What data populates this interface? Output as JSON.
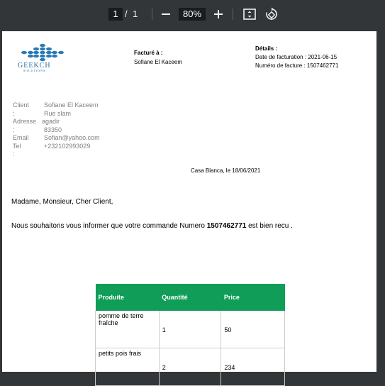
{
  "toolbar": {
    "current_page": "1",
    "separator": "/",
    "total_pages": "1",
    "zoom": "80%",
    "icons": [
      "zoom-out-icon",
      "zoom-in-icon",
      "fit-page-icon",
      "rotate-icon"
    ]
  },
  "invoice": {
    "logo_text": "GEEKCH",
    "logo_sub": "SOLUTIONS",
    "billed_to_label": "Facturé à :",
    "billed_to_name": "Sofiane El Kaceem",
    "details_label": "Détails :",
    "invoice_date": "Date de facturation : 2021-06-15",
    "invoice_number": "Numéro de facture : 1507462771",
    "client": {
      "client_label": "Client :",
      "name": "Sofiane El Kaceem",
      "street": "Rue slam",
      "address_label": "Adresse :",
      "city": "agadir",
      "postal": "83350",
      "email_label": "Email :",
      "email": "Sofian@yahoo.com",
      "tel_label": "Tel :",
      "tel": "+232102993029"
    },
    "place_date": "Casa Blanca, le 18/06/2021",
    "greeting": "Madame, Monsieur, Cher Client,",
    "message_before": "Nous souhaitons vous informer que votre commande Numero ",
    "message_number": "1507462771",
    "message_after": " est bien recu .",
    "table": {
      "headers": [
        "Produite",
        "Quantité",
        "Price"
      ],
      "rows": [
        [
          "pomme de terre fraîche",
          "1",
          "50"
        ],
        [
          "petits pois frais",
          "2",
          "234"
        ]
      ]
    }
  },
  "colors": {
    "toolbar_bg": "#323639",
    "table_header_bg": "#0f9d58",
    "client_text": "#808080",
    "logo": "#2a6b9b"
  }
}
